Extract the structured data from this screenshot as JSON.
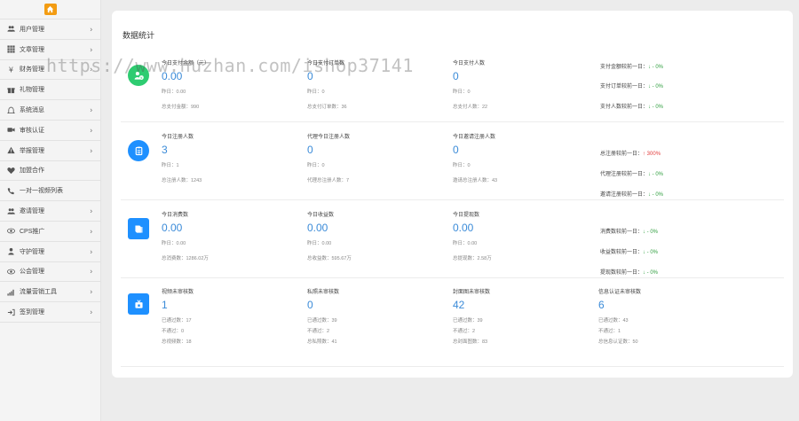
{
  "sidebar": {
    "home_color": "#f39c12",
    "items": [
      {
        "label": "用户管理",
        "icon": "users-icon",
        "chevron": true
      },
      {
        "label": "文章管理",
        "icon": "grid-icon",
        "chevron": true
      },
      {
        "label": "财务管理",
        "icon": "yen-icon",
        "chevron": true
      },
      {
        "label": "礼物管理",
        "icon": "gift-icon",
        "chevron": false
      },
      {
        "label": "系统消息",
        "icon": "bell-icon",
        "chevron": true
      },
      {
        "label": "审核认证",
        "icon": "video-icon",
        "chevron": true
      },
      {
        "label": "举报管理",
        "icon": "warning-icon",
        "chevron": true
      },
      {
        "label": "加盟合作",
        "icon": "heart-icon",
        "chevron": false
      },
      {
        "label": "一对一视频列表",
        "icon": "phone-icon",
        "chevron": false
      },
      {
        "label": "邀请管理",
        "icon": "users2-icon",
        "chevron": true
      },
      {
        "label": "CPS推广",
        "icon": "eye-icon",
        "chevron": true
      },
      {
        "label": "守护管理",
        "icon": "shield-icon",
        "chevron": true
      },
      {
        "label": "公会管理",
        "icon": "eye2-icon",
        "chevron": true
      },
      {
        "label": "流量营销工具",
        "icon": "signal-icon",
        "chevron": true
      },
      {
        "label": "签到管理",
        "icon": "signin-icon",
        "chevron": true
      }
    ]
  },
  "main": {
    "title": "数据统计",
    "watermark": "https://www.huzhan.com/ishop37141",
    "rows": [
      {
        "icon": "money-icon",
        "stats": [
          {
            "label": "今日支付金额（元）",
            "value": "0.00",
            "sub1": "昨日：0.00",
            "sub2": "总支付金额：990"
          },
          {
            "label": "今日支付订单数",
            "value": "0",
            "sub1": "昨日：0",
            "sub2": "总支付订单数：36"
          },
          {
            "label": "今日支付人数",
            "value": "0",
            "sub1": "昨日：0",
            "sub2": "总支付人数：22"
          }
        ],
        "compare": [
          {
            "text": "支付金额较前一日：",
            "dir": "down",
            "value": "↓ - 0%"
          },
          {
            "text": "支付订单较前一日：",
            "dir": "down",
            "value": "↓ - 0%"
          },
          {
            "text": "支付人数较前一日：",
            "dir": "down",
            "value": "↓ - 0%"
          }
        ]
      },
      {
        "icon": "clipboard-icon",
        "stats": [
          {
            "label": "今日注册人数",
            "value": "3",
            "sub1": "昨日：1",
            "sub2": "总注册人数：1243"
          },
          {
            "label": "代理今日注册人数",
            "value": "0",
            "sub1": "昨日：0",
            "sub2": "代理总注册人数：7"
          },
          {
            "label": "今日邀请注册人数",
            "value": "0",
            "sub1": "昨日：0",
            "sub2": "邀请总注册人数：43"
          }
        ],
        "compare": [
          {
            "text": "总注册较前一日：",
            "dir": "up",
            "value": "↑ 300%"
          },
          {
            "text": "代理注册较前一日：",
            "dir": "down",
            "value": "↓ - 0%"
          },
          {
            "text": "邀请注册较前一日：",
            "dir": "down",
            "value": "↓ - 0%"
          }
        ]
      },
      {
        "icon": "book-icon",
        "stats": [
          {
            "label": "今日消费数",
            "value": "0.00",
            "sub1": "昨日：0.00",
            "sub2": "总消费数：1286.02万"
          },
          {
            "label": "今日收益数",
            "value": "0.00",
            "sub1": "昨日：0.00",
            "sub2": "总收益数：595.67万"
          },
          {
            "label": "今日提现数",
            "value": "0.00",
            "sub1": "昨日：0.00",
            "sub2": "总提现数：2.58万"
          }
        ],
        "compare": [
          {
            "text": "消费数较前一日：",
            "dir": "down",
            "value": "↓ - 0%"
          },
          {
            "text": "收益数较前一日：",
            "dir": "down",
            "value": "↓ - 0%"
          },
          {
            "text": "提现数较前一日：",
            "dir": "down",
            "value": "↓ - 0%"
          }
        ]
      },
      {
        "icon": "tv-icon",
        "stats": [
          {
            "label": "视频未审核数",
            "value": "1",
            "sub1": "已通过数：17",
            "sub1b": "不通过：0",
            "sub2": "总视频数：18"
          },
          {
            "label": "私照未审核数",
            "value": "0",
            "sub1": "已通过数：39",
            "sub1b": "不通过：2",
            "sub2": "总私照数：41"
          },
          {
            "label": "封面图未审核数",
            "value": "42",
            "sub1": "已通过数：39",
            "sub1b": "不通过：2",
            "sub2": "总封面图数：83"
          },
          {
            "label": "信息认证未审核数",
            "value": "6",
            "sub1": "已通过数：43",
            "sub1b": "不通过：1",
            "sub2": "总信息认证数：50"
          }
        ]
      }
    ]
  }
}
